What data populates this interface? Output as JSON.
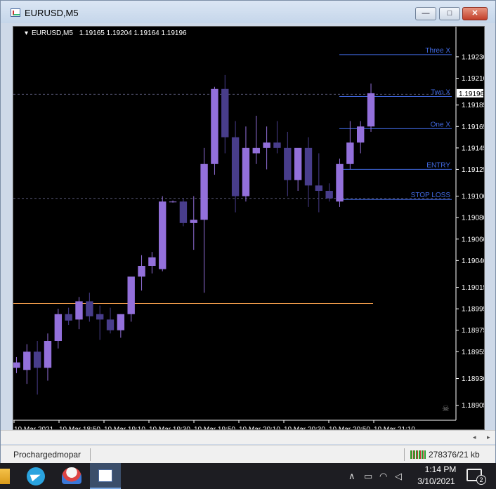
{
  "window": {
    "title": "EURUSD,M5",
    "min_label": "—",
    "max_label": "□",
    "close_label": "✕",
    "icon": "metatrader-chart-icon"
  },
  "chart": {
    "header_symbol": "EURUSD,M5",
    "header_prices": "1.19165 1.19204 1.19164 1.19196",
    "current_price_label": "1.19196",
    "colors": {
      "background": "#000000",
      "bull": "#9370DB",
      "bear": "#483D8B",
      "level_line": "#4169E1",
      "level_text": "#4169E1",
      "orange_line": "#FFA54F",
      "axis_text": "#ffffff"
    }
  },
  "chart_data": {
    "type": "candlestick",
    "symbol": "EURUSD",
    "timeframe": "M5",
    "ylim": [
      1.18895,
      1.19245
    ],
    "y_ticks": [
      "1.19230",
      "1.19210",
      "1.19185",
      "1.19165",
      "1.19145",
      "1.19125",
      "1.19100",
      "1.19080",
      "1.19060",
      "1.19040",
      "1.19015",
      "1.18995",
      "1.18975",
      "1.18955",
      "1.18930",
      "1.18905"
    ],
    "x_ticks": [
      "10 Mar 2021",
      "10 Mar 18:50",
      "10 Mar 19:10",
      "10 Mar 19:30",
      "10 Mar 19:50",
      "10 Mar 20:10",
      "10 Mar 20:30",
      "10 Mar 20:50",
      "10 Mar 21:10"
    ],
    "candles": [
      {
        "o": 1.1894,
        "h": 1.1895,
        "l": 1.18935,
        "c": 1.18945
      },
      {
        "o": 1.18938,
        "h": 1.18962,
        "l": 1.18925,
        "c": 1.18955
      },
      {
        "o": 1.18955,
        "h": 1.18965,
        "l": 1.18915,
        "c": 1.1894
      },
      {
        "o": 1.1894,
        "h": 1.18972,
        "l": 1.18928,
        "c": 1.18965
      },
      {
        "o": 1.18965,
        "h": 1.18995,
        "l": 1.18958,
        "c": 1.1899
      },
      {
        "o": 1.1899,
        "h": 1.18996,
        "l": 1.1898,
        "c": 1.18984
      },
      {
        "o": 1.18985,
        "h": 1.19006,
        "l": 1.18976,
        "c": 1.19002
      },
      {
        "o": 1.19002,
        "h": 1.1901,
        "l": 1.18983,
        "c": 1.18988
      },
      {
        "o": 1.1899,
        "h": 1.18998,
        "l": 1.18966,
        "c": 1.18985
      },
      {
        "o": 1.18985,
        "h": 1.18996,
        "l": 1.18972,
        "c": 1.18975
      },
      {
        "o": 1.18975,
        "h": 1.1899,
        "l": 1.18968,
        "c": 1.1899
      },
      {
        "o": 1.1899,
        "h": 1.1902,
        "l": 1.18983,
        "c": 1.19025
      },
      {
        "o": 1.19025,
        "h": 1.19045,
        "l": 1.19012,
        "c": 1.19035
      },
      {
        "o": 1.19035,
        "h": 1.19048,
        "l": 1.19028,
        "c": 1.19043
      },
      {
        "o": 1.19032,
        "h": 1.191,
        "l": 1.1903,
        "c": 1.19095
      },
      {
        "o": 1.19095,
        "h": 1.19096,
        "l": 1.19094,
        "c": 1.19095
      },
      {
        "o": 1.19095,
        "h": 1.19098,
        "l": 1.19072,
        "c": 1.19075
      },
      {
        "o": 1.19075,
        "h": 1.191,
        "l": 1.1905,
        "c": 1.19078
      },
      {
        "o": 1.19078,
        "h": 1.19145,
        "l": 1.1901,
        "c": 1.1913
      },
      {
        "o": 1.1913,
        "h": 1.19202,
        "l": 1.1912,
        "c": 1.192
      },
      {
        "o": 1.192,
        "h": 1.19213,
        "l": 1.1914,
        "c": 1.19155
      },
      {
        "o": 1.19155,
        "h": 1.1917,
        "l": 1.19085,
        "c": 1.191
      },
      {
        "o": 1.191,
        "h": 1.19165,
        "l": 1.19095,
        "c": 1.19145
      },
      {
        "o": 1.1914,
        "h": 1.19175,
        "l": 1.1913,
        "c": 1.19145
      },
      {
        "o": 1.19145,
        "h": 1.19165,
        "l": 1.19125,
        "c": 1.1915
      },
      {
        "o": 1.1915,
        "h": 1.1917,
        "l": 1.1914,
        "c": 1.19145
      },
      {
        "o": 1.19145,
        "h": 1.1916,
        "l": 1.191,
        "c": 1.19115
      },
      {
        "o": 1.19115,
        "h": 1.19135,
        "l": 1.19105,
        "c": 1.19145
      },
      {
        "o": 1.19145,
        "h": 1.19155,
        "l": 1.1909,
        "c": 1.1911
      },
      {
        "o": 1.1911,
        "h": 1.1914,
        "l": 1.19085,
        "c": 1.19105
      },
      {
        "o": 1.19105,
        "h": 1.19112,
        "l": 1.19095,
        "c": 1.19098
      },
      {
        "o": 1.19095,
        "h": 1.19135,
        "l": 1.1909,
        "c": 1.1913
      },
      {
        "o": 1.1913,
        "h": 1.1917,
        "l": 1.19125,
        "c": 1.1915
      },
      {
        "o": 1.1915,
        "h": 1.1917,
        "l": 1.1914,
        "c": 1.19165
      },
      {
        "o": 1.19165,
        "h": 1.19205,
        "l": 1.1916,
        "c": 1.19196
      }
    ],
    "levels": [
      {
        "label": "Three X",
        "price": 1.19232,
        "style": "solid"
      },
      {
        "label": "Two X",
        "price": 1.19193,
        "style": "solid"
      },
      {
        "label": "One X",
        "price": 1.19163,
        "style": "solid"
      },
      {
        "label": "ENTRY",
        "price": 1.19125,
        "style": "solid"
      },
      {
        "label": "STOP LOSS",
        "price": 1.19097,
        "style": "solid"
      }
    ],
    "dashed_levels": [
      1.19195,
      1.19098
    ],
    "orange_level": 1.19
  },
  "scrollbar": {
    "left_arrow": "◂",
    "right_arrow": "▸"
  },
  "status": {
    "user": "Prochargedmopar",
    "traffic": "278376/21 kb"
  },
  "taskbar": {
    "time": "1:14 PM",
    "date": "3/10/2021",
    "notifications": "2",
    "tray_icons": [
      "chevron-up-icon",
      "battery-icon",
      "wifi-icon",
      "volume-icon"
    ],
    "apps": [
      "file-explorer-icon",
      "telegram-icon",
      "parachute-app-icon",
      "metatrader-icon"
    ]
  }
}
